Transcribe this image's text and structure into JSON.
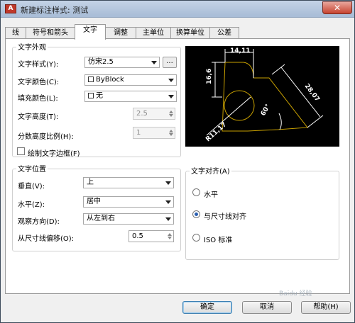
{
  "window": {
    "title": "新建标注样式: 测试",
    "app_icon": "A",
    "close_glyph": "✕"
  },
  "tabs": [
    {
      "label": "线",
      "active": false
    },
    {
      "label": "符号和箭头",
      "active": false
    },
    {
      "label": "文字",
      "active": true
    },
    {
      "label": "调整",
      "active": false
    },
    {
      "label": "主单位",
      "active": false
    },
    {
      "label": "换算单位",
      "active": false
    },
    {
      "label": "公差",
      "active": false
    }
  ],
  "text_appearance": {
    "title": "文字外观",
    "style_label": "文字样式(Y):",
    "style_value": "仿宋2.5",
    "style_browse_label": "...",
    "color_label": "文字颜色(C):",
    "color_value": "ByBlock",
    "fill_label": "填充颜色(L):",
    "fill_value": "无",
    "height_label": "文字高度(T):",
    "height_value": "2.5",
    "fraction_label": "分数高度比例(H):",
    "fraction_value": "1",
    "frame_label": "绘制文字边框(F)"
  },
  "text_placement": {
    "title": "文字位置",
    "vertical_label": "垂直(V):",
    "vertical_value": "上",
    "horizontal_label": "水平(Z):",
    "horizontal_value": "居中",
    "view_dir_label": "观察方向(D):",
    "view_dir_value": "从左到右",
    "offset_label": "从尺寸线偏移(O):",
    "offset_value": "0.5"
  },
  "text_alignment": {
    "title": "文字对齐(A)",
    "options": [
      {
        "label": "水平",
        "checked": false
      },
      {
        "label": "与尺寸线对齐",
        "checked": true
      },
      {
        "label": "ISO 标准",
        "checked": false
      }
    ]
  },
  "preview": {
    "dims": [
      "14,11",
      "16,6",
      "28,07",
      "60°",
      "R11,17"
    ]
  },
  "buttons": {
    "ok": "确定",
    "cancel": "取消",
    "help": "帮助(H)"
  },
  "watermark": "Baidu 经验",
  "colors": {
    "preview_bg": "#000000",
    "preview_geometry": "#c8a000",
    "preview_dims": "#ffffff"
  }
}
